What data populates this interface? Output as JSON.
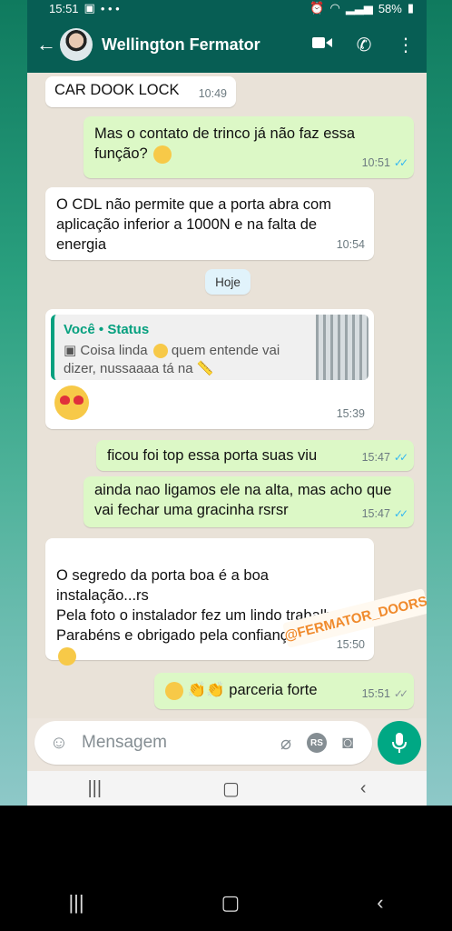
{
  "status_bar": {
    "time": "15:51",
    "battery": "58%"
  },
  "header": {
    "back_icon": "arrow-left-icon",
    "contact_name": "Wellington Fermator"
  },
  "messages": [
    {
      "text": "CAR DOOK LOCK",
      "time": "10:49"
    },
    {
      "text": "Mas o contato de trinco já não faz essa função?",
      "time": "10:51"
    },
    {
      "text": "O CDL não permite que a porta abra com aplicação inferior a 1000N e na falta de energia",
      "time": "10:54"
    },
    {
      "quote_author": "Você • Status",
      "quote_text_1": "Coisa linda",
      "quote_text_2": "quem entende vai dizer, nussaaaa tá na",
      "time": "15:39"
    },
    {
      "text": "ficou foi top essa porta suas viu",
      "time": "15:47"
    },
    {
      "text": "ainda nao ligamos ele na alta, mas acho que vai fechar uma gracinha rsrsr",
      "time": "15:47"
    },
    {
      "text": "O segredo da porta boa é a boa instalação...rs\nPela foto o instalador fez um lindo trabalho. Parabéns e obrigado pela confiança..",
      "time": "15:50"
    },
    {
      "text": "parceria forte",
      "time": "15:51"
    }
  ],
  "day_chip": "Hoje",
  "watermark": "@FERMATOR_DOORS",
  "composer": {
    "placeholder": "Mensagem",
    "rs_label": "RS"
  },
  "colors": {
    "header": "#075e54",
    "outgoing": "#dcf8c6",
    "incoming": "#ffffff",
    "accent": "#00a884",
    "read_ticks": "#34b7f1"
  }
}
